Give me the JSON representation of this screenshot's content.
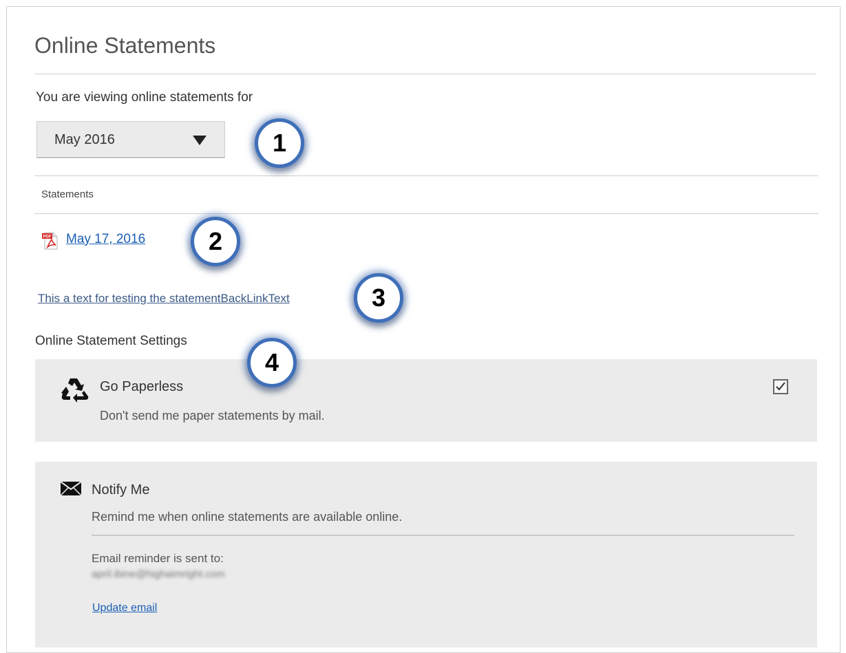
{
  "page": {
    "title": "Online Statements"
  },
  "viewing": {
    "label": "You are viewing online statements for",
    "selected_month": "May 2016"
  },
  "statements": {
    "header": "Statements",
    "items": [
      {
        "date": "May 17, 2016",
        "icon": "pdf-icon"
      }
    ]
  },
  "back_link_text": "This a text for testing the statementBackLinkText",
  "settings": {
    "heading": "Online Statement Settings",
    "go_paperless": {
      "title": "Go Paperless",
      "description": "Don't send me paper statements by mail.",
      "checked": true,
      "icon": "recycle-icon"
    },
    "notify_me": {
      "title": "Notify Me",
      "description": "Remind me when online statements are available online.",
      "email_label": "Email reminder is sent to:",
      "email_value": "april.ibine@highaimright.com",
      "update_link": "Update email",
      "icon": "envelope-icon"
    }
  },
  "callouts": [
    "1",
    "2",
    "3",
    "4"
  ],
  "colors": {
    "link": "#1a5fb4",
    "callout_ring": "#3f6fb8",
    "box_bg": "#ebebeb"
  }
}
